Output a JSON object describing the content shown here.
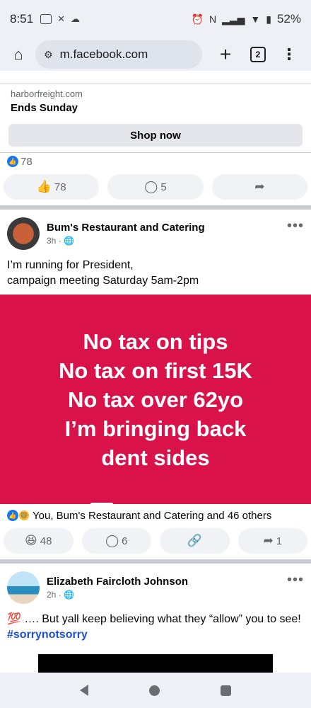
{
  "status_bar": {
    "time": "8:51",
    "battery": "52%"
  },
  "browser": {
    "url": "m.facebook.com",
    "tab_count": "2"
  },
  "ad_post": {
    "domain": "harborfreight.com",
    "title": "Ends Sunday",
    "cta": "Shop now",
    "reaction_count": "78",
    "like_count": "78",
    "comment_count": "5"
  },
  "post1": {
    "author": "Bum's Restaurant and Catering",
    "time": "3h",
    "text_line1": "I’m running for President,",
    "text_line2": "campaign meeting Saturday 5am-2pm",
    "card_lines": [
      "No tax on tips",
      "No tax on first 15K",
      "No tax over 62yo",
      "I’m bringing back",
      "dent sides"
    ],
    "reactions_text": "You, Bum's Restaurant and Catering and 46 others",
    "reaction_count": "48",
    "comment_count": "6",
    "share_count": "1"
  },
  "post2": {
    "author": "Elizabeth Faircloth Johnson",
    "time": "2h",
    "text_emoji": "💯",
    "text": " …. But yall keep believing what they “allow” you to see! ",
    "hashtag": "#sorrynotsorry"
  },
  "colors": {
    "card_red": "#d9124a",
    "facebook_blue": "#1877f2",
    "hashtag_blue": "#1b4fd8"
  }
}
